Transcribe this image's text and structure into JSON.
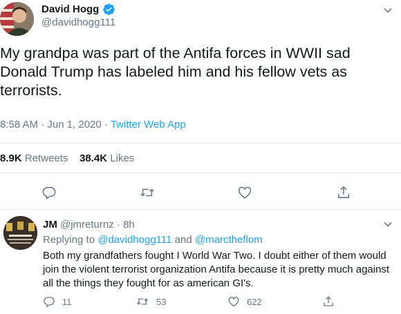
{
  "tweet": {
    "author_name": "David Hogg",
    "author_handle": "@davidhogg111",
    "text": "My grandpa was part of the Antifa forces in WWII sad Donald Trump has labeled him and his fellow vets as terrorists.",
    "time": "8:58 AM · Jun 1, 2020 · ",
    "source": "Twitter Web App",
    "retweets_count": "8.9K",
    "retweets_label": "Retweets",
    "likes_count": "38.4K",
    "likes_label": "Likes"
  },
  "reply": {
    "author_name": "JM",
    "author_handle": "@jmreturnz",
    "time": "· 8h",
    "replying_prefix": "Replying to ",
    "replying_to_1": "@davidhogg111",
    "replying_and": " and ",
    "replying_to_2": "@marctheflom",
    "text": "Both my grandfathers fought I World War Two. I doubt either of them would join the violent terrorist organization Antifa because it is pretty much against all the things they fought for as american GI's.",
    "reply_count": "11",
    "retweet_count": "53",
    "like_count": "622"
  },
  "colors": {
    "accent": "#1da1f2",
    "secondary_text": "#657786",
    "divider": "#e6ecf0"
  },
  "icons": [
    "verified-badge-icon",
    "chevron-down-icon",
    "reply-icon",
    "retweet-icon",
    "like-icon",
    "share-icon"
  ]
}
